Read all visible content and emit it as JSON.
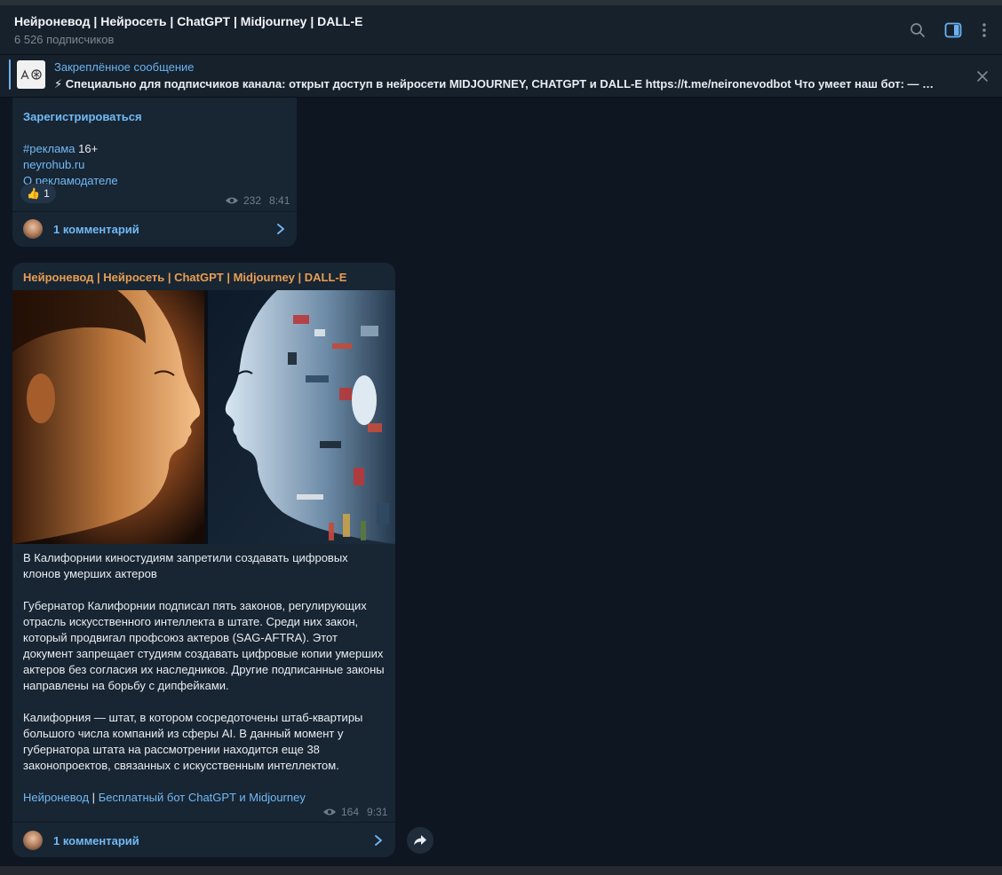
{
  "header": {
    "title": "Нейроневод | Нейросеть | ChatGPT | Midjourney | DALL-E",
    "subscribers": "6 526 подписчиков"
  },
  "pinned": {
    "label": "Закреплённое сообщение",
    "text": "⚡ Специально для подписчиков канала: открыт доступ в нейросети MIDJOURNEY, CHATGPT и DALL-E  https://t.me/neironevodbot  Что умеет наш бот:   — …"
  },
  "message1": {
    "register_label": "Зарегистрироваться",
    "ad_tag": "#реклама",
    "age_rating": "16+",
    "site": "neyrohub.ru",
    "advertiser_link": "О рекламодателе",
    "reaction_emoji": "👍",
    "reaction_count": "1",
    "views": "232",
    "time": "8:41",
    "comments_label": "1 комментарий"
  },
  "message2": {
    "author": "Нейроневод | Нейросеть | ChatGPT | Midjourney | DALL-E",
    "headline": "В Калифорнии киностудиям запретили создавать цифровых клонов умерших актеров",
    "paragraph1": "Губернатор Калифорнии подписал пять законов, регулирующих отрасль искусственного интеллекта в штате. Среди них закон, который продвигал профсоюз актеров (SAG-AFTRA). Этот документ запрещает студиям создавать цифровые копии умерших актеров без согласия их наследников. Другие подписанные законы направлены на борьбу с дипфейками.",
    "paragraph2": "Калифорния — штат, в котором сосредоточены штаб-квартиры большого числа компаний из сферы AI. В данный момент у губернатора штата на рассмотрении находится еще 38 законопроектов, связанных с искусственным интеллектом.",
    "footer_link1": "Нейроневод",
    "footer_sep": "|",
    "footer_link2": "Бесплатный бот ChatGPT и Midjourney",
    "views": "164",
    "time": "9:31",
    "comments_label": "1 комментарий"
  },
  "colors": {
    "background": "#0e1621",
    "panel": "#17212b",
    "bubble": "#182533",
    "link": "#71baf5",
    "author": "#e89e52"
  },
  "icons": [
    "search-icon",
    "sidebar-toggle-icon",
    "more-vertical-icon",
    "close-icon",
    "eye-icon",
    "chevron-right-icon",
    "share-icon"
  ]
}
